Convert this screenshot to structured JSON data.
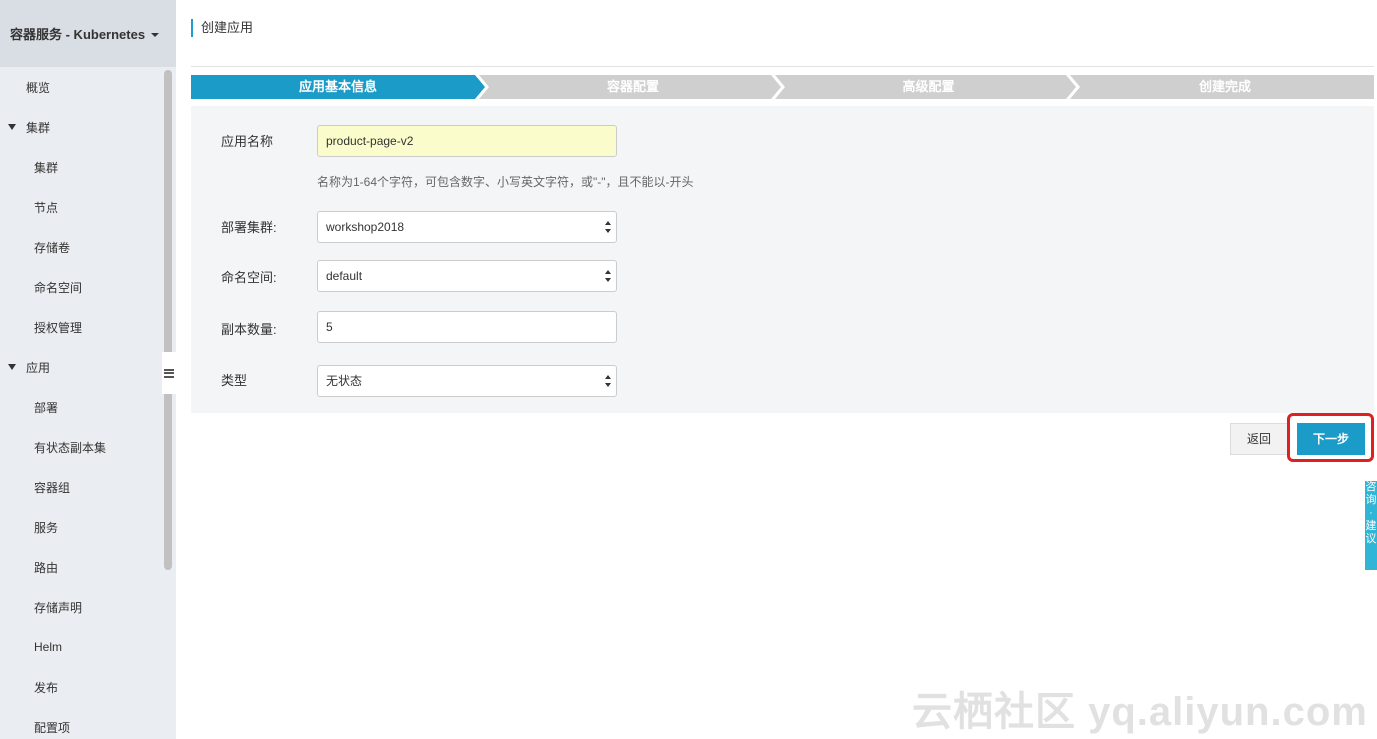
{
  "sidebar": {
    "header": "容器服务 - Kubernetes",
    "items": [
      {
        "label": "概览"
      },
      {
        "label": "集群"
      },
      {
        "label": "集群"
      },
      {
        "label": "节点"
      },
      {
        "label": "存储卷"
      },
      {
        "label": "命名空间"
      },
      {
        "label": "授权管理"
      },
      {
        "label": "应用"
      },
      {
        "label": "部署"
      },
      {
        "label": "有状态副本集"
      },
      {
        "label": "容器组"
      },
      {
        "label": "服务"
      },
      {
        "label": "路由"
      },
      {
        "label": "存储声明"
      },
      {
        "label": "Helm"
      },
      {
        "label": "发布"
      },
      {
        "label": "配置项"
      }
    ]
  },
  "page": {
    "title": "创建应用"
  },
  "steps": [
    {
      "label": "应用基本信息",
      "state": "active"
    },
    {
      "label": "容器配置",
      "state": "inactive"
    },
    {
      "label": "高级配置",
      "state": "inactive"
    },
    {
      "label": "创建完成",
      "state": "inactive"
    }
  ],
  "form": {
    "app_name": {
      "label": "应用名称",
      "value": "product-page-v2",
      "hint": "名称为1-64个字符，可包含数字、小写英文字符，或\"-\"，且不能以-开头"
    },
    "cluster": {
      "label": "部署集群:",
      "value": "workshop2018"
    },
    "namespace": {
      "label": "命名空间:",
      "value": "default"
    },
    "replicas": {
      "label": "副本数量:",
      "value": "5"
    },
    "type": {
      "label": "类型",
      "value": "无状态"
    }
  },
  "actions": {
    "back": "返回",
    "next": "下一步"
  },
  "float_tab": "咨询·建议",
  "watermark": "云栖社区 yq.aliyun.com",
  "colors": {
    "accent": "#1a9bc8",
    "highlight_border": "#e02020",
    "step_inactive": "#cfcfcf",
    "input_highlight": "#fafccb"
  }
}
